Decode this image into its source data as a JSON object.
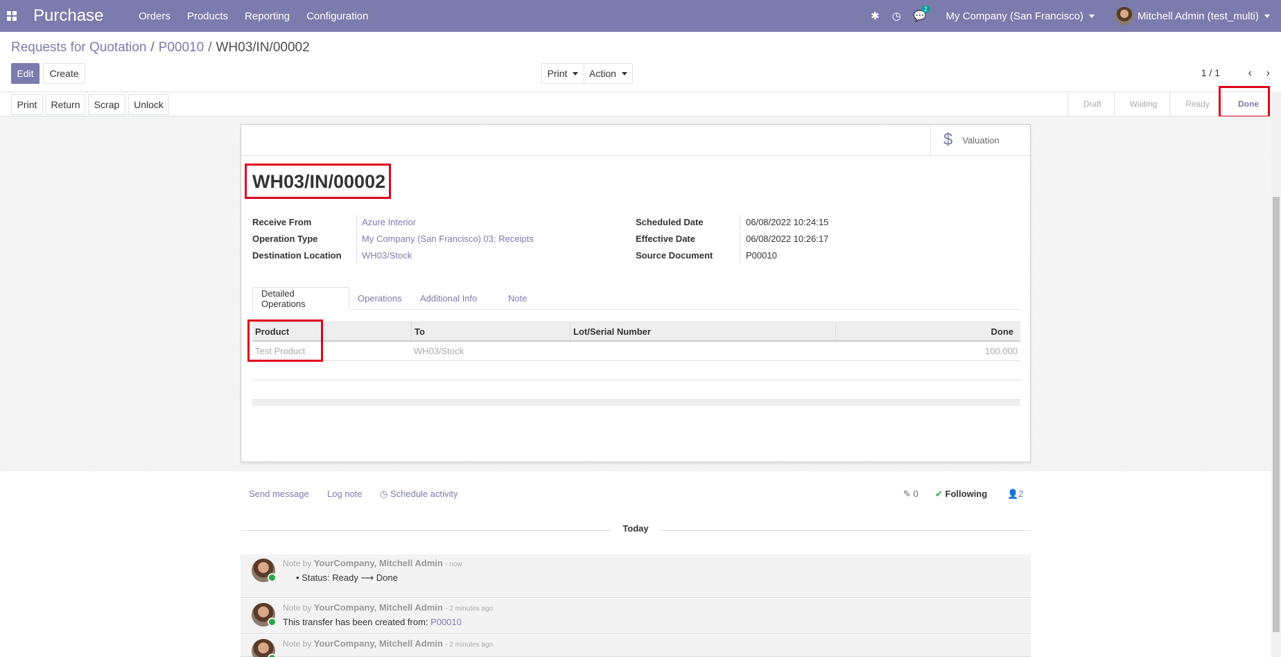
{
  "navbar": {
    "app_name": "Purchase",
    "menu": [
      "Orders",
      "Products",
      "Reporting",
      "Configuration"
    ],
    "chat_badge": "2",
    "company": "My Company (San Francisco)",
    "user": "Mitchell Admin (test_multi)"
  },
  "breadcrumb": {
    "root": "Requests for Quotation",
    "parent": "P00010",
    "current": "WH03/IN/00002",
    "sep": "/"
  },
  "controls": {
    "edit": "Edit",
    "create": "Create",
    "print": "Print",
    "action": "Action",
    "pager": "1 / 1"
  },
  "statusbar": {
    "buttons": [
      "Print",
      "Return",
      "Scrap",
      "Unlock"
    ],
    "states": [
      "Draft",
      "Waiting",
      "Ready",
      "Done"
    ],
    "active_state": "Done"
  },
  "sheet": {
    "valuation": "Valuation",
    "title": "WH03/IN/00002",
    "fields_left": [
      {
        "label": "Receive From",
        "value": "Azure Interior"
      },
      {
        "label": "Operation Type",
        "value": "My Company (San Francisco) 03: Receipts"
      },
      {
        "label": "Destination Location",
        "value": "WH03/Stock"
      }
    ],
    "fields_right": [
      {
        "label": "Scheduled Date",
        "value": "06/08/2022 10:24:15"
      },
      {
        "label": "Effective Date",
        "value": "06/08/2022 10:26:17"
      },
      {
        "label": "Source Document",
        "value": "P00010"
      }
    ],
    "tabs": [
      "Detailed Operations",
      "Operations",
      "Additional Info",
      "Note"
    ],
    "table": {
      "headers": [
        "Product",
        "To",
        "Lot/Serial Number",
        "Done"
      ],
      "rows": [
        {
          "product": "Test Product",
          "to": "WH03/Stock",
          "lot": "",
          "done": "100.000"
        }
      ]
    }
  },
  "chatter": {
    "send_message": "Send message",
    "log_note": "Log note",
    "schedule_activity": "Schedule activity",
    "attachments": "0",
    "following": "Following",
    "followers": "2",
    "today": "Today",
    "messages": [
      {
        "prefix": "Note by",
        "author": "YourCompany, Mitchell Admin",
        "time": "- now",
        "status_from": "Status: Ready",
        "status_to": "Done"
      },
      {
        "prefix": "Note by",
        "author": "YourCompany, Mitchell Admin",
        "time": "- 2 minutes ago",
        "body": "This transfer has been created from:",
        "link": "P00010"
      },
      {
        "prefix": "Note by",
        "author": "YourCompany, Mitchell Admin",
        "time": "- 2 minutes ago"
      }
    ]
  }
}
